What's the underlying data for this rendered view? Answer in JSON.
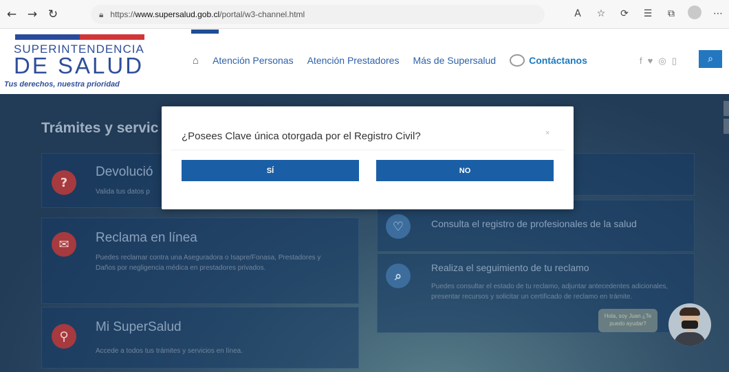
{
  "browser": {
    "url_prefix": "https://",
    "url_host": "www.supersalud.gob.cl",
    "url_path": "/portal/w3-channel.html",
    "icons": [
      "back-icon",
      "forward-icon",
      "reload-icon",
      "lock-icon",
      "read-aloud-icon",
      "favorite-icon",
      "extensions-icon",
      "favorites-bar-icon",
      "collections-icon",
      "profile-icon",
      "more-icon"
    ]
  },
  "header": {
    "logo_top": "SUPERINTENDENCIA",
    "logo_main": "DE SALUD",
    "tagline": "Tus derechos, nuestra prioridad",
    "nav": {
      "personas": "Atención Personas",
      "prestadores": "Atención Prestadores",
      "mas": "Más de Supersalud",
      "contacto": "Contáctanos"
    },
    "social": [
      "f",
      "♥",
      "◎",
      "▯"
    ]
  },
  "page": {
    "section_title": "Trámites y servic",
    "tiles": {
      "devolucion": {
        "title": "Devolució",
        "desc": "Valida tus datos p"
      },
      "reclama": {
        "title": "Reclama en línea",
        "desc": "Puedes reclamar contra una Aseguradora o Isapre/Fonasa, Prestadores y Daños por negligencia médica en prestadores privados."
      },
      "mi_supersalud": {
        "title": "Mi SuperSalud",
        "desc": "Accede a todos tus trámites y servicios en línea."
      },
      "consulta": {
        "title": "Consulta el registro de profesionales de la salud"
      },
      "seguimiento": {
        "title": "Realiza el seguimiento de tu reclamo",
        "desc": "Puedes consultar el estado de tu reclamo, adjuntar antecedentes adicionales, presentar recursos y solicitar un certificado de reclamo en trámite."
      }
    },
    "chat_text": "Hola, soy Juan ¿Te puedo ayudar?"
  },
  "modal": {
    "question": "¿Posees Clave única otorgada por el Registro Civil?",
    "close": "×",
    "yes_label": "SÍ",
    "no_label": "NO"
  }
}
